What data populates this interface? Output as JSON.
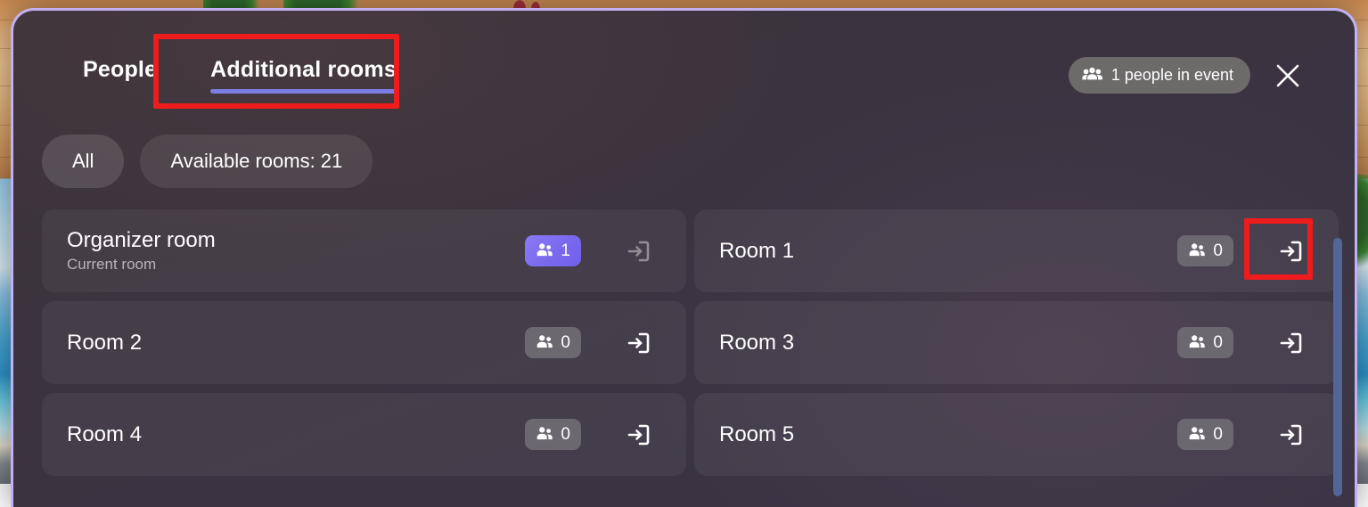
{
  "header": {
    "tabs": [
      {
        "label": "People",
        "active": false,
        "name": "tab-people"
      },
      {
        "label": "Additional rooms",
        "active": true,
        "name": "tab-additional-rooms"
      }
    ],
    "people_badge": {
      "icon": "people-group-icon",
      "label": "1 people in event"
    },
    "close_icon": "close-icon"
  },
  "filters": [
    {
      "label": "All",
      "selected": true
    },
    {
      "label": "Available rooms: 21",
      "selected": false
    }
  ],
  "rooms": [
    {
      "name": "Organizer room",
      "subtitle": "Current room",
      "count": "1",
      "count_highlight": true,
      "enter_enabled": false,
      "enter_icon": "enter-room-icon"
    },
    {
      "name": "Room 1",
      "subtitle": "",
      "count": "0",
      "count_highlight": false,
      "enter_enabled": true,
      "enter_icon": "enter-room-icon"
    },
    {
      "name": "Room 2",
      "subtitle": "",
      "count": "0",
      "count_highlight": false,
      "enter_enabled": true,
      "enter_icon": "enter-room-icon"
    },
    {
      "name": "Room 3",
      "subtitle": "",
      "count": "0",
      "count_highlight": false,
      "enter_enabled": true,
      "enter_icon": "enter-room-icon"
    },
    {
      "name": "Room 4",
      "subtitle": "",
      "count": "0",
      "count_highlight": false,
      "enter_enabled": true,
      "enter_icon": "enter-room-icon"
    },
    {
      "name": "Room 5",
      "subtitle": "",
      "count": "0",
      "count_highlight": false,
      "enter_enabled": true,
      "enter_icon": "enter-room-icon"
    }
  ],
  "colors": {
    "accent_purple": "#7d7ee3",
    "badge_highlight": "#7a69ee",
    "annotation_red": "#ee1c1c",
    "scrollbar_blue": "#52669a",
    "modal_border": "#c3b0f2"
  }
}
